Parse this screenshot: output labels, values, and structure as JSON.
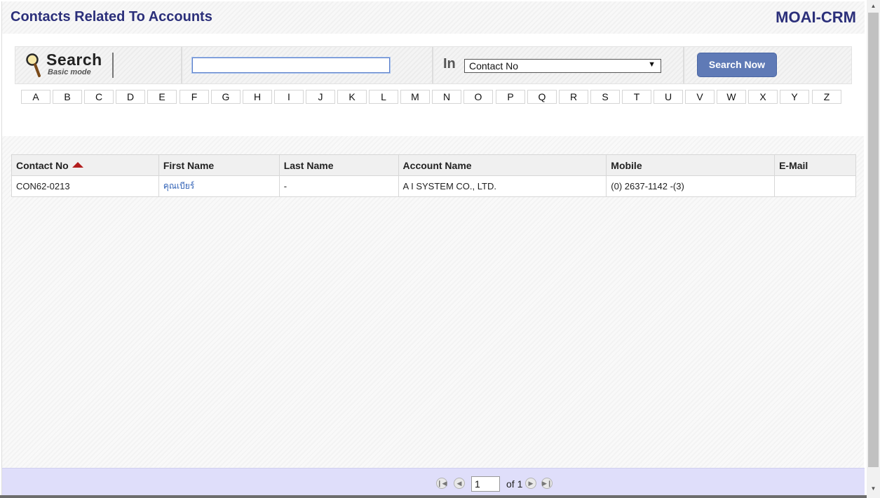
{
  "header": {
    "title": "Contacts Related To Accounts",
    "brand": "MOAI-CRM"
  },
  "search": {
    "logo_title": "Search",
    "logo_subtitle": "Basic mode",
    "query_value": "",
    "in_label": "In",
    "field_selected": "Contact No",
    "button_label": "Search Now"
  },
  "alphabet": [
    "A",
    "B",
    "C",
    "D",
    "E",
    "F",
    "G",
    "H",
    "I",
    "J",
    "K",
    "L",
    "M",
    "N",
    "O",
    "P",
    "Q",
    "R",
    "S",
    "T",
    "U",
    "V",
    "W",
    "X",
    "Y",
    "Z"
  ],
  "table": {
    "columns": [
      "Contact No",
      "First Name",
      "Last Name",
      "Account Name",
      "Mobile",
      "E-Mail"
    ],
    "sorted_column": "Contact No",
    "sort_direction": "ascending",
    "rows": [
      {
        "contact_no": "CON62-0213",
        "first_name": "คุณเบียร์",
        "last_name": "-",
        "account_name": "A I SYSTEM CO., LTD.",
        "mobile": "(0) 2637-1142 -(3)",
        "email": ""
      }
    ]
  },
  "pagination": {
    "current_page": "1",
    "of_label": "of 1"
  },
  "colors": {
    "title": "#2b2f7a",
    "button": "#5f7ab6",
    "link": "#2d5fb5",
    "footer": "#dfdefa",
    "sort_arrow": "#b21e1e"
  }
}
